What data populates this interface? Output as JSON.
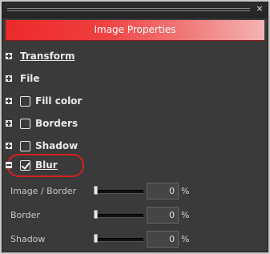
{
  "panel": {
    "title": "Image Properties",
    "close_icon_char": "×"
  },
  "sections": [
    {
      "label": "Transform",
      "state": "collapsed",
      "checkbox": null
    },
    {
      "label": "File",
      "state": "collapsed",
      "checkbox": null
    },
    {
      "label": "Fill color",
      "state": "collapsed",
      "checkbox": false
    },
    {
      "label": "Borders",
      "state": "collapsed",
      "checkbox": false
    },
    {
      "label": "Shadow",
      "state": "collapsed",
      "checkbox": false
    },
    {
      "label": "Blur",
      "state": "expanded",
      "checkbox": true,
      "highlighted": true
    }
  ],
  "blur": {
    "rows": [
      {
        "label": "Image / Border",
        "value": "0",
        "unit": "%"
      },
      {
        "label": "Border",
        "value": "0",
        "unit": "%"
      },
      {
        "label": "Shadow",
        "value": "0",
        "unit": "%"
      }
    ]
  },
  "colors": {
    "title_gradient_start": "#ec2a2a",
    "title_gradient_end": "#f4b3b3",
    "panel_bg": "#3a3a3a",
    "highlight_ring": "#d52020"
  }
}
